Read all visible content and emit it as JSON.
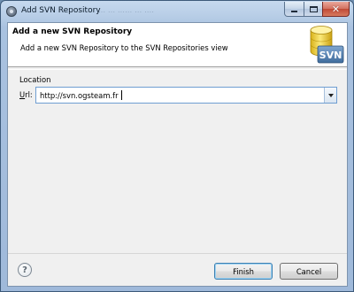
{
  "window": {
    "title": "Add SVN Repository",
    "background_ghost_text": "...  ...  ......  ...  ...."
  },
  "banner": {
    "title": "Add a new SVN Repository",
    "description": "Add a new SVN Repository to the SVN Repositories view",
    "logo_text": "SVN"
  },
  "form": {
    "group_label": "Location",
    "url_label_underlined": "U",
    "url_label_rest": "rl:",
    "url_value": "http://svn.ogsteam.fr"
  },
  "buttons": {
    "help": "?",
    "finish": "Finish",
    "cancel": "Cancel"
  },
  "colors": {
    "client_bg": "#f0f0f0",
    "banner_bg": "#ffffff",
    "input_border": "#6f9ed1",
    "close_button": "#c04a36"
  }
}
